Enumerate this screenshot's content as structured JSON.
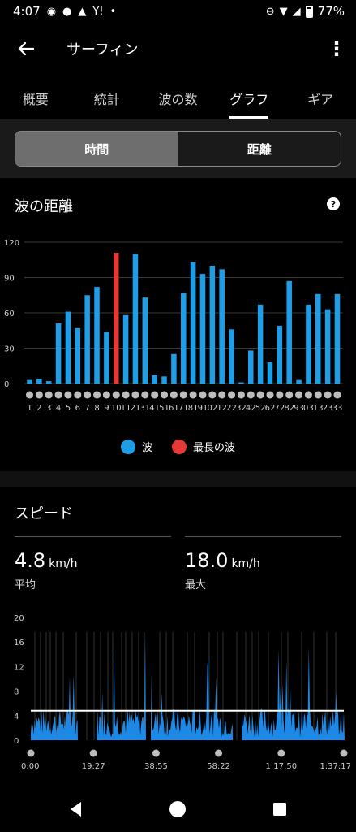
{
  "status": {
    "time": "4:07",
    "battery": "77%"
  },
  "app_bar": {
    "title": "サーフィン"
  },
  "tabs": [
    {
      "label": "概要"
    },
    {
      "label": "統計"
    },
    {
      "label": "波の数"
    },
    {
      "label": "グラフ",
      "active": true
    },
    {
      "label": "ギア"
    }
  ],
  "segment": {
    "left": "時間",
    "right": "距離",
    "active": "時間"
  },
  "wave_section": {
    "title": "波の距離",
    "help": "?"
  },
  "speed_section": {
    "title": "スピード",
    "avg": {
      "value": "4.8",
      "unit": "km/h",
      "label": "平均"
    },
    "max": {
      "value": "18.0",
      "unit": "km/h",
      "label": "最大"
    }
  },
  "colors": {
    "wave": "#1e9ee6",
    "longest": "#e53935",
    "speed_fill": "#1e88e5"
  },
  "icons": [
    "back-arrow-icon",
    "more-vert-icon",
    "help-icon",
    "nav-back-icon",
    "nav-home-icon",
    "nav-recents-icon"
  ],
  "chart_data": [
    {
      "type": "bar",
      "categories": [
        "1",
        "2",
        "3",
        "4",
        "5",
        "6",
        "7",
        "8",
        "9",
        "10",
        "11",
        "12",
        "13",
        "14",
        "15",
        "16",
        "17",
        "18",
        "19",
        "20",
        "21",
        "22",
        "23",
        "24",
        "25",
        "26",
        "27",
        "28",
        "29",
        "30",
        "31",
        "32",
        "33"
      ],
      "x_tick_labels": [
        "1",
        "2",
        "3",
        "4",
        "5",
        "6",
        "7",
        "8",
        "9",
        "10",
        "11",
        "21",
        "31",
        "41",
        "51",
        "61",
        "71",
        "81",
        "91",
        "02",
        "12",
        "22",
        "32",
        "42",
        "52",
        "62",
        "72",
        "82",
        "93",
        "03",
        "13",
        "23",
        "33"
      ],
      "series": [
        {
          "name": "波",
          "values": [
            3,
            4,
            2,
            51,
            61,
            47,
            75,
            82,
            44,
            111,
            58,
            110,
            73,
            7,
            6,
            25,
            77,
            103,
            93,
            100,
            97,
            46,
            1,
            28,
            67,
            18,
            49,
            87,
            3,
            67,
            76,
            63,
            76
          ]
        }
      ],
      "highlight": {
        "name": "最長の波",
        "index": 9
      },
      "legend": [
        "波",
        "最長の波"
      ],
      "yticks": [
        0,
        30,
        60,
        90,
        120
      ],
      "ylim": [
        0,
        120
      ],
      "grid": true,
      "legend_placement": "bottom"
    },
    {
      "type": "area",
      "x_tick_labels": [
        "0:00",
        "19:27",
        "38:55",
        "58:22",
        "1:17:50",
        "1:37:17"
      ],
      "x_seconds": [
        0,
        1167,
        2335,
        3502,
        4670,
        5837
      ],
      "yticks": [
        0,
        4,
        8,
        12,
        16,
        20
      ],
      "ylim": [
        0,
        20
      ],
      "average": 4.8,
      "max": 18.0,
      "grid": true
    }
  ]
}
